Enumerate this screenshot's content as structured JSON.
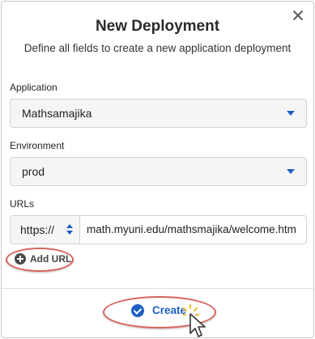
{
  "dialog": {
    "title": "New Deployment",
    "subtitle": "Define all fields to create a new application deployment"
  },
  "fields": {
    "application": {
      "label": "Application",
      "value": "Mathsamajika"
    },
    "environment": {
      "label": "Environment",
      "value": "prod"
    },
    "urls": {
      "label": "URLs",
      "protocol": "https://",
      "value": "math.myuni.edu/mathsmajika/welcome.htm"
    }
  },
  "actions": {
    "add_url_label": "Add URL",
    "create_label": "Create"
  },
  "colors": {
    "accent": "#1d5fc4",
    "highlight": "#d9625a"
  },
  "icons": {
    "close": "close-icon",
    "add": "plus-circle-icon",
    "create": "check-circle-icon",
    "cursor": "pointer-cursor-icon"
  }
}
